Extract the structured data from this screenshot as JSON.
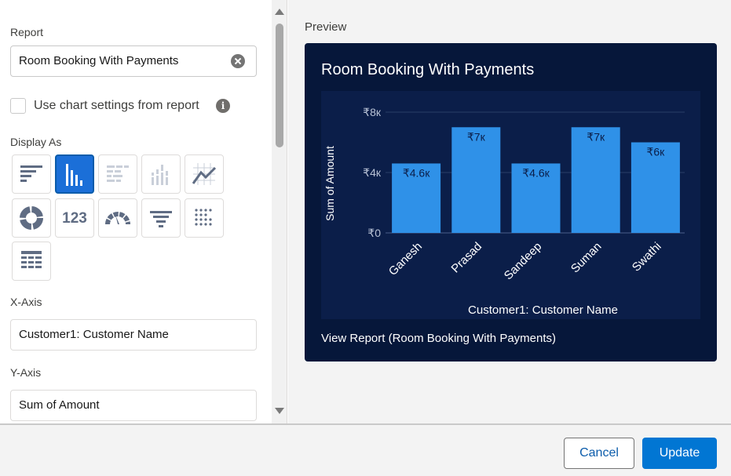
{
  "left": {
    "report_label": "Report",
    "report_value": "Room Booking With Payments",
    "checkbox_label": "Use chart settings from report",
    "checkbox_checked": false,
    "display_as_label": "Display As",
    "chart_types": [
      {
        "name": "horizontal-bar-icon"
      },
      {
        "name": "vertical-bar-icon",
        "selected": true
      },
      {
        "name": "stacked-horizontal-bar-icon"
      },
      {
        "name": "stacked-vertical-bar-icon"
      },
      {
        "name": "line-chart-icon"
      },
      {
        "name": "donut-chart-icon"
      },
      {
        "name": "metric-icon",
        "text": "123"
      },
      {
        "name": "gauge-icon"
      },
      {
        "name": "funnel-icon"
      },
      {
        "name": "scatter-icon"
      },
      {
        "name": "table-icon"
      }
    ],
    "xaxis_label": "X-Axis",
    "xaxis_value": "Customer1: Customer Name",
    "yaxis_label": "Y-Axis",
    "yaxis_value": "Sum of Amount"
  },
  "preview": {
    "label": "Preview",
    "title": "Room Booking With Payments",
    "view_report": "View Report (Room Booking With Payments)"
  },
  "chart_data": {
    "type": "bar",
    "categories": [
      "Ganesh",
      "Prasad",
      "Sandeep",
      "Suman",
      "Swathi"
    ],
    "values": [
      4600,
      7000,
      4600,
      7000,
      6000
    ],
    "data_labels": [
      "₹4.6к",
      "₹7к",
      "₹4.6к",
      "₹7к",
      "₹6к"
    ],
    "xlabel": "Customer1: Customer Name",
    "ylabel": "Sum of Amount",
    "ylim": [
      0,
      8000
    ],
    "yticks": [
      0,
      4000,
      8000
    ],
    "ytick_labels": [
      "₹0",
      "₹4к",
      "₹8к"
    ],
    "bar_color": "#2f91e8",
    "grid": true
  },
  "footer": {
    "cancel_label": "Cancel",
    "update_label": "Update"
  },
  "colors": {
    "accent": "#0176d3",
    "preview_bg": "#06173a"
  }
}
